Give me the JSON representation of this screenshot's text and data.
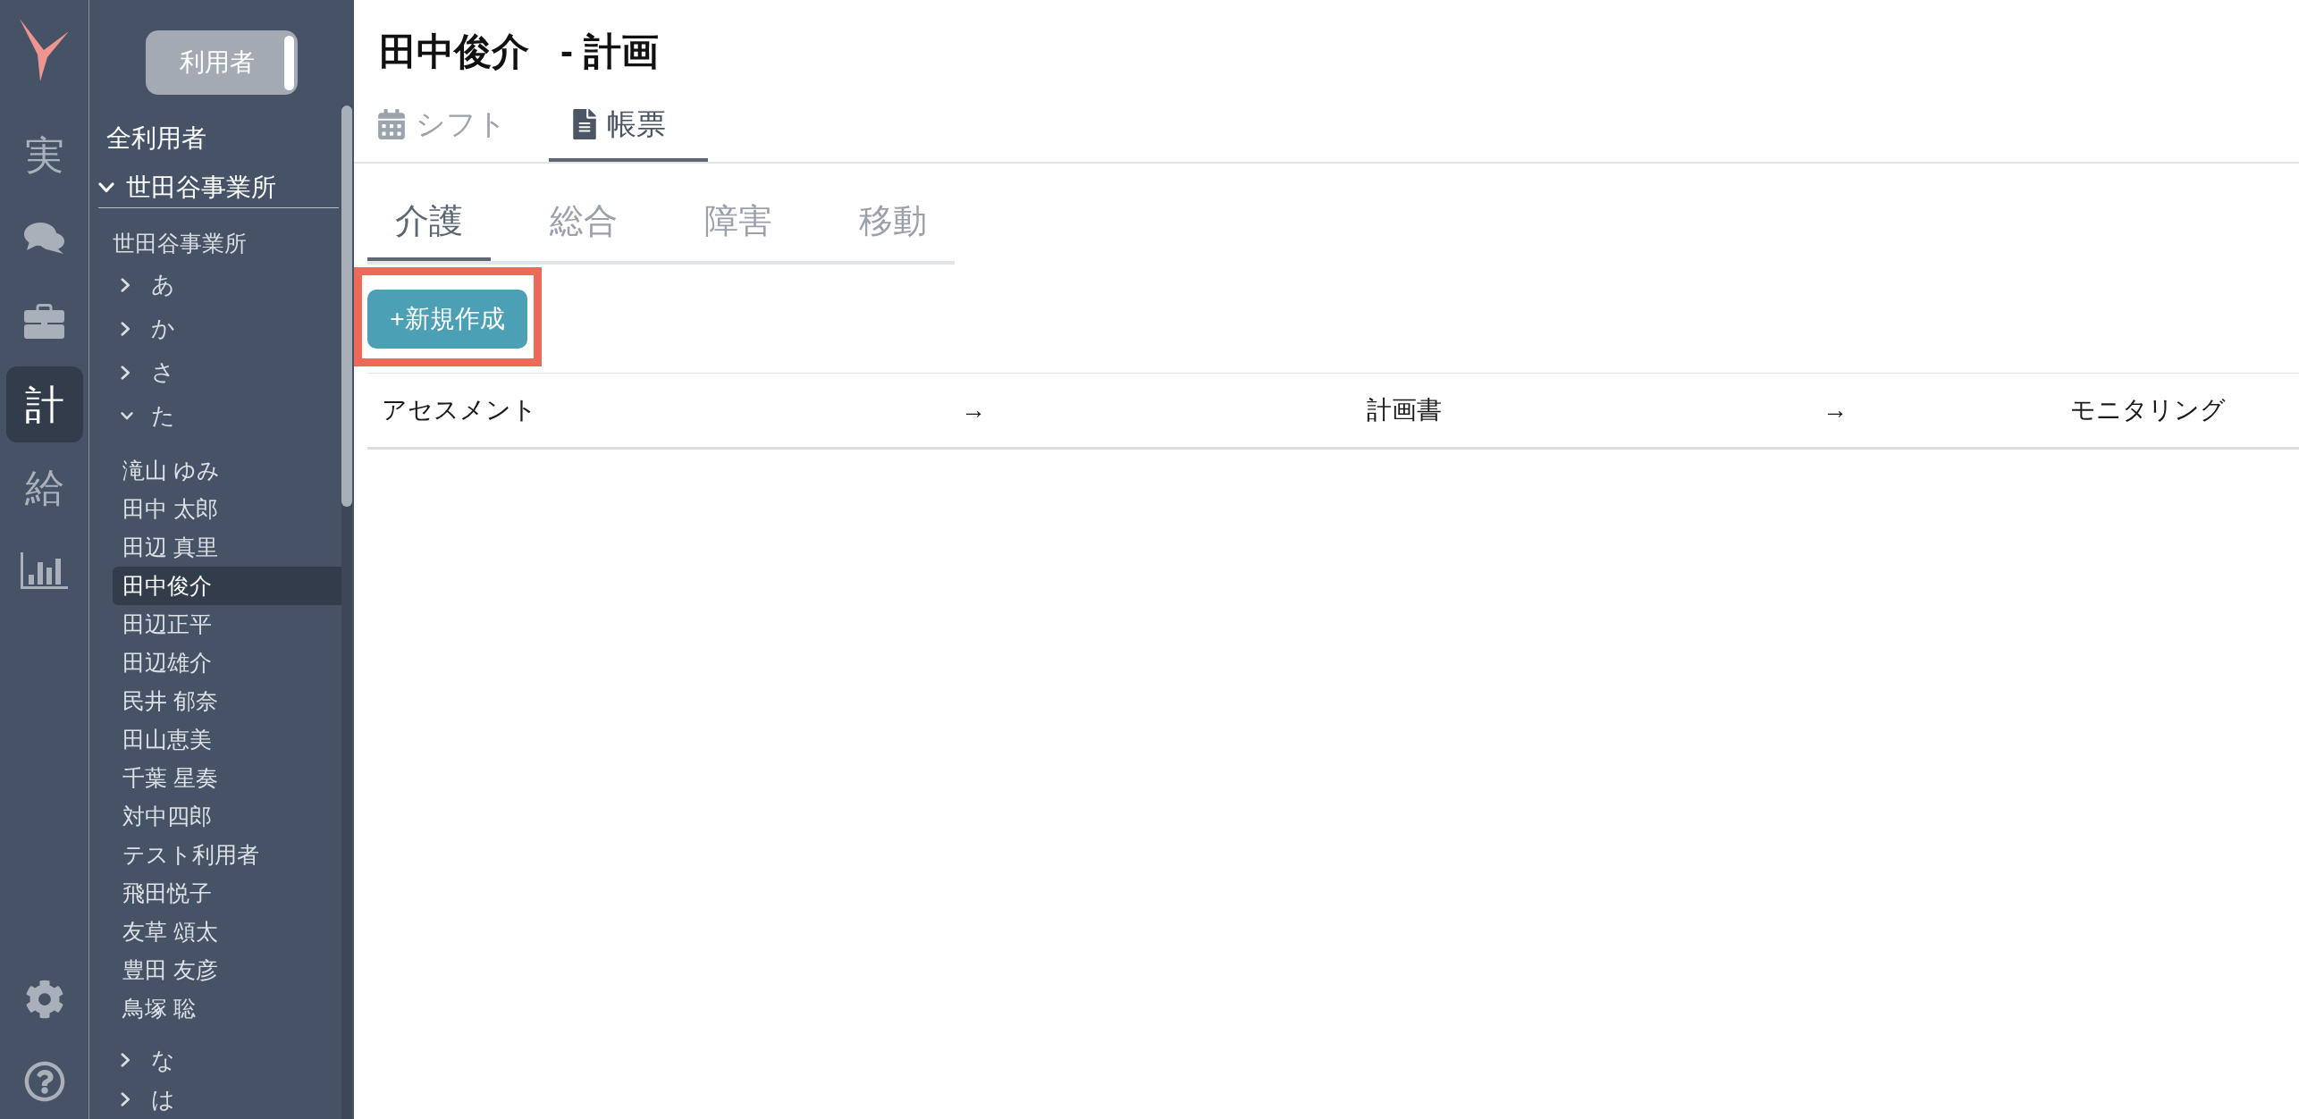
{
  "rail": {
    "items": [
      {
        "kind": "text",
        "label": "実",
        "selected": false
      },
      {
        "kind": "chat",
        "selected": false
      },
      {
        "kind": "briefcase",
        "selected": false
      },
      {
        "kind": "text",
        "label": "計",
        "selected": true
      },
      {
        "kind": "text",
        "label": "給",
        "selected": false
      },
      {
        "kind": "chart",
        "selected": false
      }
    ],
    "bottom_items": [
      {
        "kind": "settings"
      },
      {
        "kind": "help"
      }
    ]
  },
  "sidebar": {
    "toggle": {
      "label": "利用者",
      "on": true
    },
    "all_users": "全利用者",
    "tree": [
      {
        "label": "世田谷事業所",
        "expanded": true,
        "children": [
          {
            "kind": "leaf",
            "label": "世田谷事業所"
          },
          {
            "kind": "group",
            "label": "あ",
            "expanded": false
          },
          {
            "kind": "group",
            "label": "か",
            "expanded": false
          },
          {
            "kind": "group",
            "label": "さ",
            "expanded": false
          },
          {
            "kind": "group",
            "label": "た",
            "expanded": true,
            "children": [
              {
                "label": "滝山 ゆみ",
                "selected": false
              },
              {
                "label": "田中 太郎",
                "selected": false
              },
              {
                "label": "田辺 真里",
                "selected": false
              },
              {
                "label": "田中俊介",
                "selected": true
              },
              {
                "label": "田辺正平",
                "selected": false
              },
              {
                "label": "田辺雄介",
                "selected": false
              },
              {
                "label": "民井 郁奈",
                "selected": false
              },
              {
                "label": "田山恵美",
                "selected": false
              },
              {
                "label": "千葉 星奏",
                "selected": false
              },
              {
                "label": "対中四郎",
                "selected": false
              },
              {
                "label": "テスト利用者",
                "selected": false
              },
              {
                "label": "飛田悦子",
                "selected": false
              },
              {
                "label": "友草 頌太",
                "selected": false
              },
              {
                "label": "豊田 友彦",
                "selected": false
              },
              {
                "label": "鳥塚 聡",
                "selected": false
              }
            ]
          },
          {
            "kind": "group",
            "label": "な",
            "expanded": false
          },
          {
            "kind": "group",
            "label": "は",
            "expanded": false
          }
        ]
      }
    ]
  },
  "header": {
    "title": "田中俊介   - 計画"
  },
  "view_tabs": [
    {
      "kind": "calendar",
      "label": "シフト",
      "selected": false
    },
    {
      "kind": "document",
      "label": "帳票",
      "selected": true
    }
  ],
  "category_tabs": [
    {
      "label": "介護",
      "selected": true
    },
    {
      "label": "総合",
      "selected": false
    },
    {
      "label": "障害",
      "selected": false
    },
    {
      "label": "移動",
      "selected": false
    }
  ],
  "new_button": {
    "label": "+新規作成",
    "highlighted": true
  },
  "table": {
    "columns": [
      "アセスメント",
      "→",
      "計画書",
      "→",
      "モニタリング"
    ]
  }
}
